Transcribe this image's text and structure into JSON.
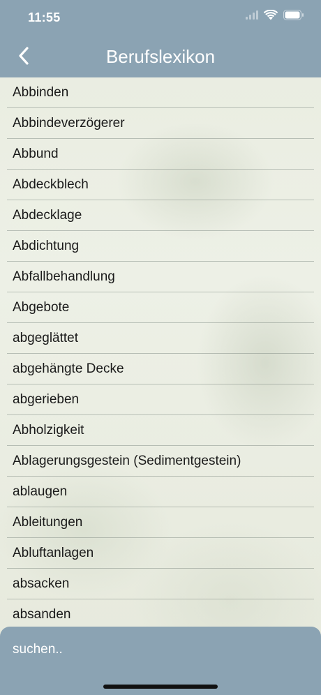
{
  "status_bar": {
    "time": "11:55"
  },
  "nav": {
    "title": "Berufslexikon",
    "back_icon": "chevron-left-icon"
  },
  "list": {
    "items": [
      "Abbinden",
      "Abbindeverzögerer",
      "Abbund",
      "Abdeckblech",
      "Abdecklage",
      "Abdichtung",
      "Abfallbehandlung",
      "Abgebote",
      "abgeglättet",
      "abgehängte Decke",
      "abgerieben",
      "Abholzigkeit",
      "Ablagerungsgestein (Sedimentgestein)",
      "ablaugen",
      "Ableitungen",
      "Abluftanlagen",
      "absacken",
      "absanden"
    ]
  },
  "search": {
    "placeholder": "suchen.."
  },
  "colors": {
    "header": "#8ba3b3",
    "search_bar": "#8ba3b3",
    "text": "#1a1a1a",
    "header_text": "#ffffff"
  }
}
